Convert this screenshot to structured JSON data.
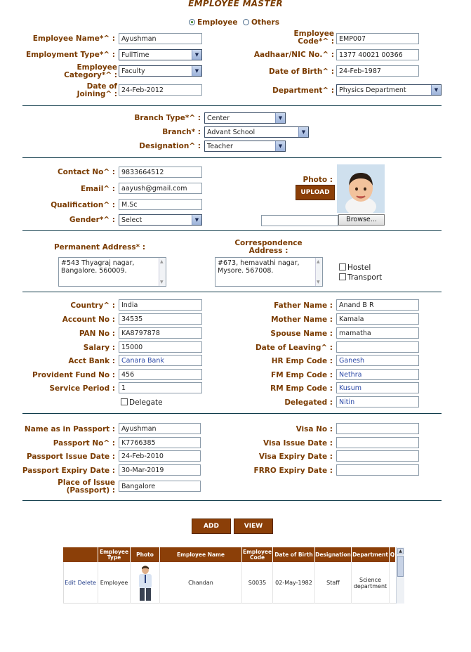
{
  "page_title": "EMPLOYEE MASTER",
  "type_options": {
    "employee": "Employee",
    "others": "Others"
  },
  "section1": {
    "employee_name": {
      "label": "Employee Name*^ :",
      "value": "Ayushman"
    },
    "employee_code": {
      "label": "Employee Code*^ :",
      "value": "EMP007"
    },
    "employment_type": {
      "label": "Employment Type*^ :",
      "value": "FullTime"
    },
    "aadhaar": {
      "label": "Aadhaar/NIC No.^ :",
      "value": "1377 40021 00366"
    },
    "employee_category": {
      "label": "Employee Category*^ :",
      "value": "Faculty"
    },
    "date_of_birth": {
      "label": "Date of Birth^ :",
      "value": "24-Feb-1987"
    },
    "date_of_joining": {
      "label": "Date of Joining^ :",
      "value": "24-Feb-2012"
    },
    "department": {
      "label": "Department^ :",
      "value": "Physics Department"
    }
  },
  "section2": {
    "branch_type": {
      "label": "Branch Type*^ :",
      "value": "Center"
    },
    "branch": {
      "label": "Branch* :",
      "value": "Advant School"
    },
    "designation": {
      "label": "Designation^ :",
      "value": "Teacher"
    }
  },
  "section3": {
    "contact_no": {
      "label": "Contact No^ :",
      "value": "9833664512"
    },
    "email": {
      "label": "Email^ :",
      "value": "aayush@gmail.com"
    },
    "qualification": {
      "label": "Qualification^ :",
      "value": "M.Sc"
    },
    "gender": {
      "label": "Gender*^ :",
      "value": "Select"
    },
    "photo_label": "Photo :",
    "upload_label": "UPLOAD",
    "browse_label": "Browse..."
  },
  "section4": {
    "permanent_label": "Permanent Address* :",
    "permanent_value": "#543 Thyagraj nagar, Bangalore. 560009.",
    "correspondence_label": "Correspondence Address :",
    "correspondence_value": "#673, hemavathi nagar, Mysore. 567008.",
    "hostel_label": "Hostel",
    "transport_label": "Transport"
  },
  "section5": {
    "country": {
      "label": "Country^ :",
      "value": "India"
    },
    "father_name": {
      "label": "Father Name :",
      "value": "Anand B R"
    },
    "account_no": {
      "label": "Account No :",
      "value": "34535"
    },
    "mother_name": {
      "label": "Mother Name :",
      "value": "Kamala"
    },
    "pan_no": {
      "label": "PAN No :",
      "value": "KA8797878"
    },
    "spouse_name": {
      "label": "Spouse Name :",
      "value": "mamatha"
    },
    "salary": {
      "label": "Salary :",
      "value": "15000"
    },
    "date_of_leaving": {
      "label": "Date of Leaving^ :",
      "value": ""
    },
    "acct_bank": {
      "label": "Acct Bank :",
      "value": "Canara Bank"
    },
    "hr_emp_code": {
      "label": "HR Emp Code :",
      "value": "Ganesh"
    },
    "provident_fund": {
      "label": "Provident Fund No :",
      "value": "456"
    },
    "fm_emp_code": {
      "label": "FM Emp Code :",
      "value": "Nethra"
    },
    "service_period": {
      "label": "Service Period :",
      "value": "1"
    },
    "rm_emp_code": {
      "label": "RM Emp Code :",
      "value": "Kusum"
    },
    "delegate_label": "Delegate",
    "delegated": {
      "label": "Delegated :",
      "value": "Nitin"
    }
  },
  "section6": {
    "passport_name": {
      "label": "Name as in Passport :",
      "value": "Ayushman"
    },
    "visa_no": {
      "label": "Visa No :",
      "value": ""
    },
    "passport_no": {
      "label": "Passport No^ :",
      "value": "K7766385"
    },
    "visa_issue": {
      "label": "Visa Issue Date :",
      "value": ""
    },
    "passport_issue": {
      "label": "Passport Issue Date :",
      "value": "24-Feb-2010"
    },
    "visa_expiry": {
      "label": "Visa Expiry Date :",
      "value": ""
    },
    "passport_expiry": {
      "label": "Passport Expiry Date :",
      "value": "30-Mar-2019"
    },
    "frro_expiry": {
      "label": "FRRO Expiry Date :",
      "value": ""
    },
    "place_of_issue": {
      "label": "Place of Issue (Passport) :",
      "value": "Bangalore"
    }
  },
  "actions": {
    "add": "ADD",
    "view": "VIEW"
  },
  "table": {
    "headers": [
      "Employee Type",
      "Photo",
      "Employee Name",
      "Employee Code",
      "Date of Birth",
      "Designation",
      "Department",
      "Q"
    ],
    "rows": [
      {
        "edit": "Edit",
        "delete": "Delete",
        "employee_type": "Employee",
        "employee_name": "Chandan",
        "employee_code": "S0035",
        "date_of_birth": "02-May-1982",
        "designation": "Staff",
        "department": "Science department"
      }
    ]
  },
  "colors": {
    "accent": "#8b3f08",
    "label": "#7a3b00",
    "divider": "#0f3b4a"
  }
}
